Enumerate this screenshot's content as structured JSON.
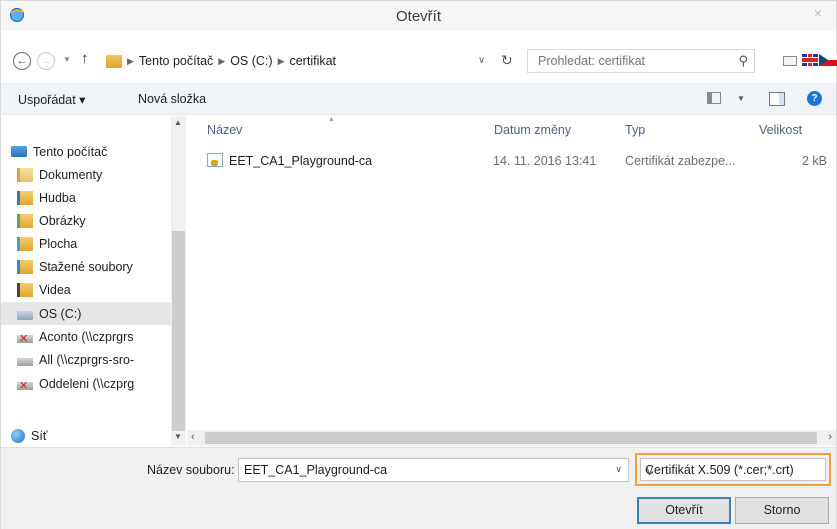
{
  "window": {
    "title": "Otevřít",
    "close_symbol": "×"
  },
  "address": {
    "crumbs": [
      "Tento počítač",
      "OS (C:)",
      "certifikat"
    ],
    "search_placeholder": "Prohledat: certifikat"
  },
  "toolbar": {
    "organize": "Uspořádat ▾",
    "new_folder": "Nová složka"
  },
  "nav": {
    "items": [
      {
        "label": "Tento počítač",
        "icon": "computer-icon"
      },
      {
        "label": "Dokumenty",
        "icon": "documents-folder-icon"
      },
      {
        "label": "Hudba",
        "icon": "music-folder-icon"
      },
      {
        "label": "Obrázky",
        "icon": "pictures-folder-icon"
      },
      {
        "label": "Plocha",
        "icon": "desktop-folder-icon"
      },
      {
        "label": "Stažené soubory",
        "icon": "downloads-folder-icon"
      },
      {
        "label": "Videa",
        "icon": "videos-folder-icon"
      },
      {
        "label": "OS (C:)",
        "icon": "drive-icon",
        "selected": true
      },
      {
        "label": "Aconto (\\\\czprgrs",
        "icon": "disconnected-network-drive-icon"
      },
      {
        "label": "All (\\\\czprgrs-sro-",
        "icon": "network-drive-icon"
      },
      {
        "label": "Oddeleni (\\\\czprg",
        "icon": "disconnected-network-drive-icon"
      },
      {
        "label": "Síť",
        "icon": "network-globe-icon"
      }
    ]
  },
  "columns": {
    "name": "Název",
    "date": "Datum změny",
    "type": "Typ",
    "size": "Velikost"
  },
  "files": [
    {
      "name": "EET_CA1_Playground-ca",
      "date": "14. 11. 2016 13:41",
      "type": "Certifikát zabezpe...",
      "size": "2 kB"
    }
  ],
  "bottom": {
    "filename_label": "Název souboru:",
    "filename_value": "EET_CA1_Playground-ca",
    "filetype": "Certifikát X.509 (*.cer;*.crt)",
    "open_button": "Otevřít",
    "cancel_button": "Storno"
  },
  "colors": {
    "accent_orange": "#f0a03a",
    "header_text": "#4d6185",
    "selected_bg": "#e6e6e6"
  }
}
